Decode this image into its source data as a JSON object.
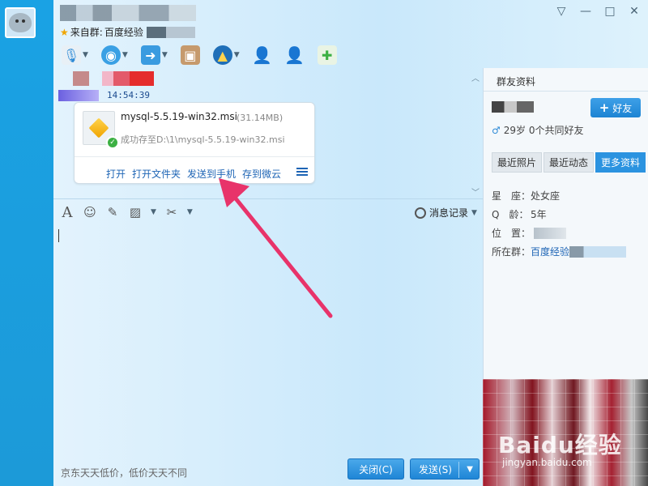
{
  "header": {
    "from_group_prefix": "来自群:",
    "from_group_name": "百度经验",
    "window_controls": [
      "▽",
      "—",
      "□",
      "✕"
    ]
  },
  "chat": {
    "time": "14:54:39",
    "file": {
      "name": "mysql-5.5.19-win32.msi",
      "size": "(31.14MB)",
      "saved_to": "成功存至D:\\1\\mysql-5.5.19-win32.msi",
      "actions": [
        "打开",
        "打开文件夹",
        "发送到手机",
        "存到微云"
      ]
    }
  },
  "input": {
    "history_label": "消息记录"
  },
  "footer": {
    "ad_text": "京东天天低价，低价天天不同",
    "close_label": "关闭(C)",
    "send_label": "发送(S)"
  },
  "side": {
    "title": "群友资料",
    "add_friend": "好友",
    "age_line": "29岁  0个共同好友",
    "tabs": [
      {
        "label": "最近照片",
        "active": false
      },
      {
        "label": "最近动态",
        "active": false
      },
      {
        "label": "更多资料",
        "active": true
      }
    ],
    "info": {
      "star_label": "星　座：",
      "star_value": "处女座",
      "q_label": "Q　龄：",
      "q_value": "5年",
      "loc_label": "位　置：",
      "group_label": "所在群：",
      "group_value": "百度经验"
    },
    "watermark": "Baidu经验",
    "watermark_sub": "jingyan.baidu.com"
  },
  "colors": {
    "accent_blue": "#1f86d6",
    "link_blue": "#1d64b5",
    "arrow_pink": "#e8336a"
  }
}
